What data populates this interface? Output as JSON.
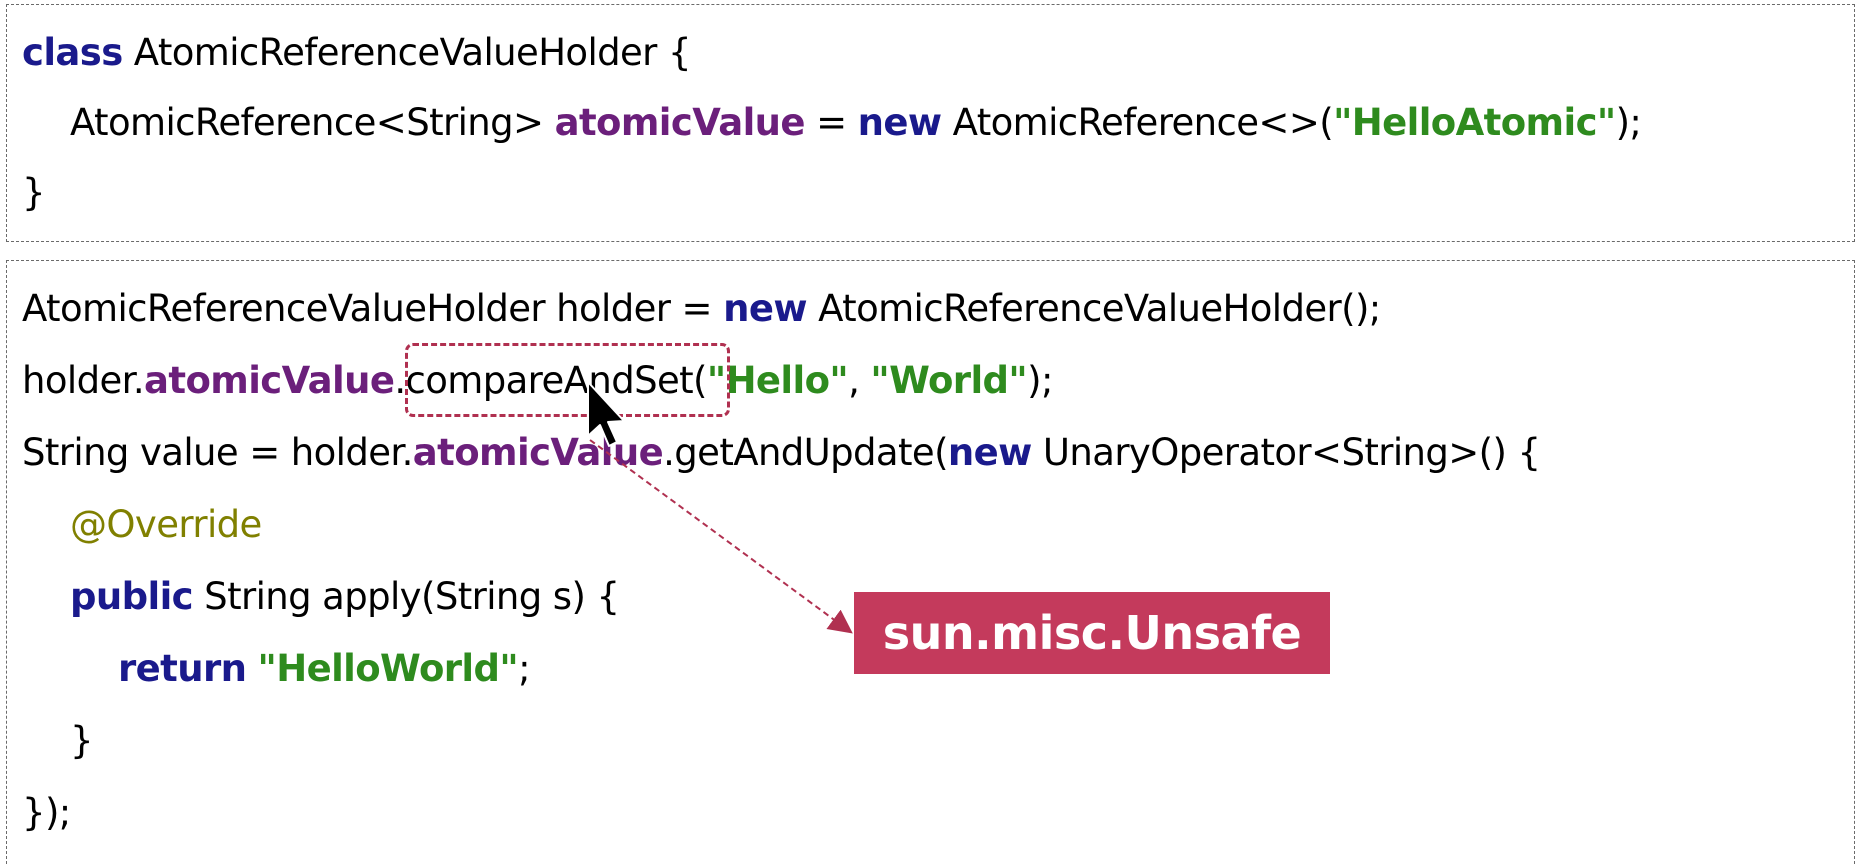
{
  "class_box": {
    "line1": {
      "kw": "class",
      "rest": " AtomicReferenceValueHolder {"
    },
    "line2": {
      "type": "AtomicReference<String> ",
      "field": "atomicValue",
      "eq": " = ",
      "kw_new": "new",
      "ctor": " AtomicReference<>(",
      "str": "\"HelloAtomic\"",
      "end": ");"
    },
    "line3": "}"
  },
  "usage_box": {
    "line1": {
      "pre": "AtomicReferenceValueHolder holder = ",
      "kw_new": "new",
      "post": " AtomicReferenceValueHolder();"
    },
    "line2": {
      "obj": "holder.",
      "field": "atomicValue",
      "method": ".compareAndSet(",
      "str1": "\"Hello\"",
      "comma": ", ",
      "str2": "\"World\"",
      "end": ");"
    },
    "line3": {
      "pre": "String value = holder.",
      "field": "atomicValue",
      "method": ".getAndUpdate(",
      "kw_new": "new",
      "post": " UnaryOperator<String>() {"
    },
    "line4": "@Override",
    "line5": {
      "kw": "public",
      "rest": " String apply(String s) {"
    },
    "line6": {
      "kw": "return",
      "space": " ",
      "str": "\"HelloWorld\"",
      "end": ";"
    },
    "line7": "}",
    "line8": "});"
  },
  "callout": {
    "label": "sun.misc.Unsafe",
    "color": "#c43a5c"
  },
  "colors": {
    "keyword": "#1a1a8c",
    "field": "#6b1f7b",
    "string": "#2e8b1e",
    "annotation": "#808000"
  }
}
